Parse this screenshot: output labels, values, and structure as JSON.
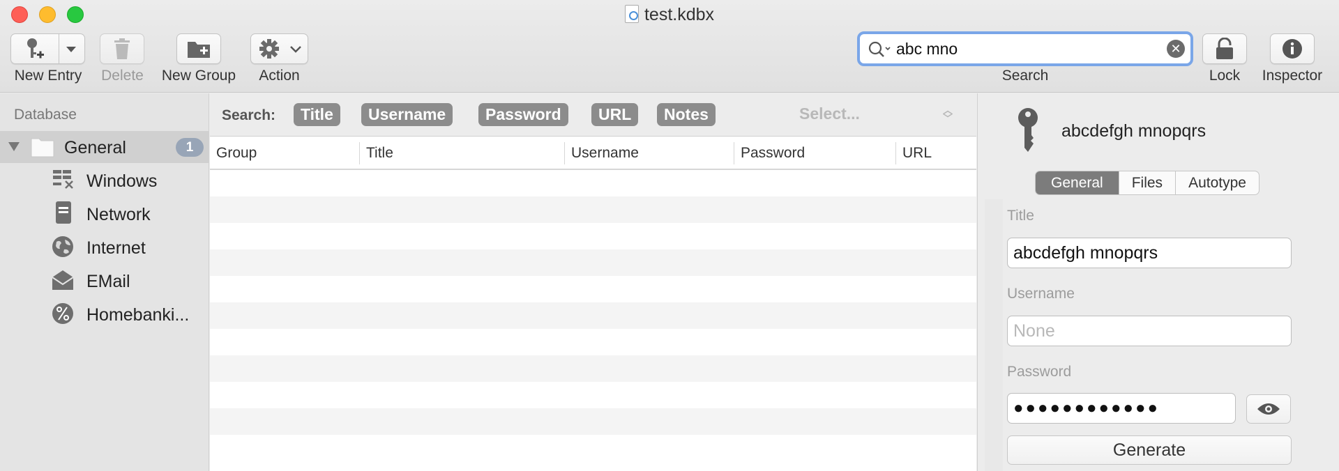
{
  "window": {
    "title": "test.kdbx"
  },
  "toolbar": {
    "new_entry_label": "New Entry",
    "delete_label": "Delete",
    "new_group_label": "New Group",
    "action_label": "Action",
    "search_label": "Search",
    "lock_label": "Lock",
    "inspector_label": "Inspector",
    "search_value": "abc mno"
  },
  "sidebar": {
    "header": "Database",
    "root": {
      "label": "General",
      "badge": "1"
    },
    "items": [
      {
        "label": "Windows",
        "icon": "windows-icon"
      },
      {
        "label": "Network",
        "icon": "server-icon"
      },
      {
        "label": "Internet",
        "icon": "globe-icon"
      },
      {
        "label": "EMail",
        "icon": "envelope-icon"
      },
      {
        "label": "Homebanki...",
        "icon": "percent-icon"
      }
    ]
  },
  "search_scope": {
    "label": "Search:",
    "buttons": [
      "Title",
      "Username",
      "Password",
      "URL",
      "Notes"
    ],
    "select_placeholder": "Select..."
  },
  "table": {
    "columns": [
      "Group",
      "Title",
      "Username",
      "Password",
      "URL"
    ]
  },
  "inspector": {
    "entry_title": "abcdefgh mnopqrs",
    "tabs": [
      "General",
      "Files",
      "Autotype"
    ],
    "active_tab": "General",
    "title_label": "Title",
    "title_value": "abcdefgh mnopqrs",
    "username_label": "Username",
    "username_placeholder": "None",
    "password_label": "Password",
    "password_masked": "●●●●●●●●●●●●",
    "generate_label": "Generate"
  },
  "colors": {
    "search_focus": "#7aa6e8",
    "scope_button": "#8c8c8c",
    "badge": "#98a5b7",
    "close": "#fe5f57",
    "minimize": "#febc2e",
    "maximize": "#28c840"
  }
}
